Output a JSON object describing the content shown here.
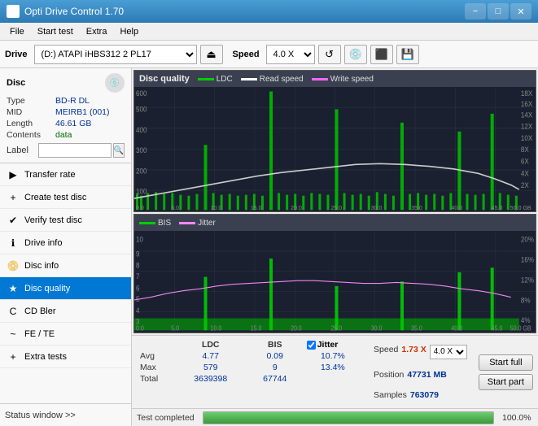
{
  "titlebar": {
    "title": "Opti Drive Control 1.70",
    "minimize": "−",
    "maximize": "□",
    "close": "✕"
  },
  "menubar": {
    "items": [
      "File",
      "Start test",
      "Extra",
      "Help"
    ]
  },
  "toolbar": {
    "drive_label": "Drive",
    "drive_value": "(D:) ATAPI iHBS312  2 PL17",
    "speed_label": "Speed",
    "speed_value": "4.0 X"
  },
  "disc": {
    "title": "Disc",
    "type_label": "Type",
    "type_value": "BD-R DL",
    "mid_label": "MID",
    "mid_value": "MEIRB1 (001)",
    "length_label": "Length",
    "length_value": "46.61 GB",
    "contents_label": "Contents",
    "contents_value": "data",
    "label_label": "Label",
    "label_value": ""
  },
  "nav": {
    "items": [
      {
        "id": "transfer-rate",
        "label": "Transfer rate",
        "icon": "▶"
      },
      {
        "id": "create-test-disc",
        "label": "Create test disc",
        "icon": "💿"
      },
      {
        "id": "verify-test-disc",
        "label": "Verify test disc",
        "icon": "✔"
      },
      {
        "id": "drive-info",
        "label": "Drive info",
        "icon": "ℹ"
      },
      {
        "id": "disc-info",
        "label": "Disc info",
        "icon": "📀"
      },
      {
        "id": "disc-quality",
        "label": "Disc quality",
        "icon": "★",
        "active": true
      },
      {
        "id": "cd-bler",
        "label": "CD Bler",
        "icon": "C"
      },
      {
        "id": "fe-te",
        "label": "FE / TE",
        "icon": "~"
      },
      {
        "id": "extra-tests",
        "label": "Extra tests",
        "icon": "+"
      }
    ]
  },
  "chart1": {
    "title": "Disc quality",
    "legends": [
      {
        "label": "LDC",
        "color": "#00aa00"
      },
      {
        "label": "Read speed",
        "color": "#ffffff"
      },
      {
        "label": "Write speed",
        "color": "#ff66ff"
      }
    ],
    "y_max": 600,
    "y_right_max": 18,
    "x_max": 50
  },
  "chart2": {
    "legends": [
      {
        "label": "BIS",
        "color": "#00aa00"
      },
      {
        "label": "Jitter",
        "color": "#ff88ff"
      }
    ],
    "y_max": 10,
    "y_right_max": 20,
    "x_max": 50
  },
  "stats": {
    "headers": [
      "",
      "LDC",
      "BIS",
      "",
      "Jitter",
      "Speed",
      ""
    ],
    "avg_label": "Avg",
    "avg_ldc": "4.77",
    "avg_bis": "0.09",
    "avg_jitter": "10.7%",
    "max_label": "Max",
    "max_ldc": "579",
    "max_bis": "9",
    "max_jitter": "13.4%",
    "total_label": "Total",
    "total_ldc": "3639398",
    "total_bis": "67744",
    "speed_label": "Speed",
    "speed_value": "1.73 X",
    "speed_select": "4.0 X",
    "position_label": "Position",
    "position_value": "47731 MB",
    "samples_label": "Samples",
    "samples_value": "763079",
    "jitter_checked": true
  },
  "actions": {
    "start_full": "Start full",
    "start_part": "Start part"
  },
  "statusbar": {
    "status_window": "Status window >>",
    "progress": 100,
    "status_text": "Test completed",
    "progress_label": "100.0%"
  }
}
